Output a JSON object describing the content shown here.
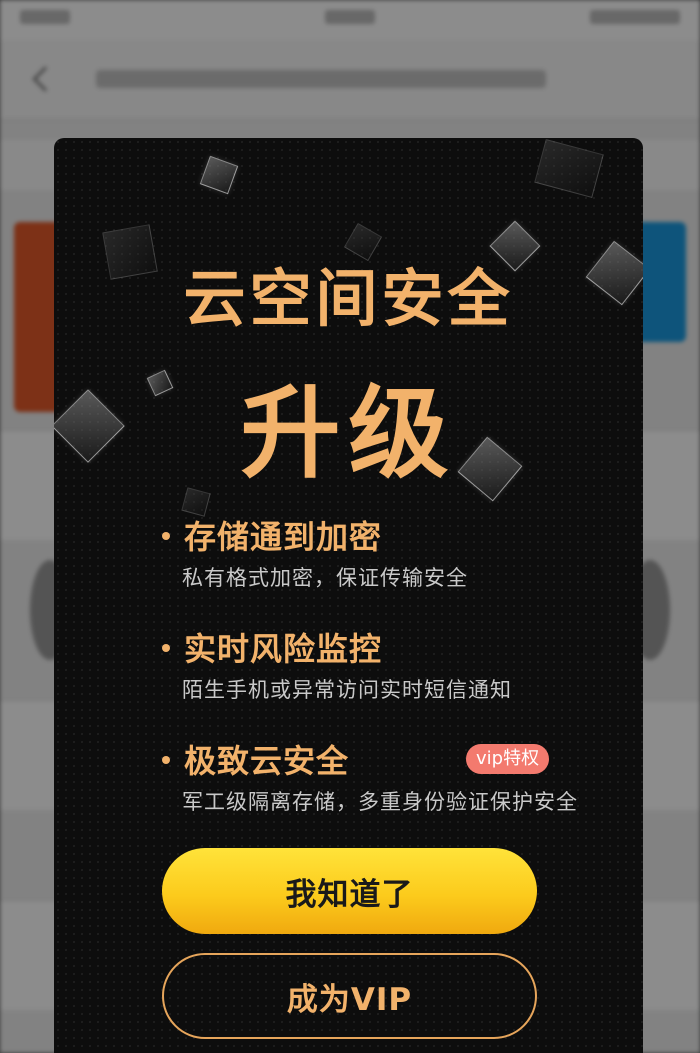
{
  "colors": {
    "accent": "#f2b26b",
    "modal_bg": "#0d0d0d",
    "primary_button": "#fccb1c",
    "vip_badge": "#f37a6e",
    "description_text": "#c9c9c9"
  },
  "modal": {
    "title": "云空间安全",
    "subtitle": "升级",
    "features": [
      {
        "title": "存储通到加密",
        "description": "私有格式加密，保证传输安全"
      },
      {
        "title": "实时风险监控",
        "description": "陌生手机或异常访问实时短信通知"
      },
      {
        "title": "极致云安全",
        "badge": "vip特权",
        "description": "军工级隔离存储，多重身份验证保护安全"
      }
    ],
    "primary_button": "我知道了",
    "secondary_button": "成为VIP"
  }
}
